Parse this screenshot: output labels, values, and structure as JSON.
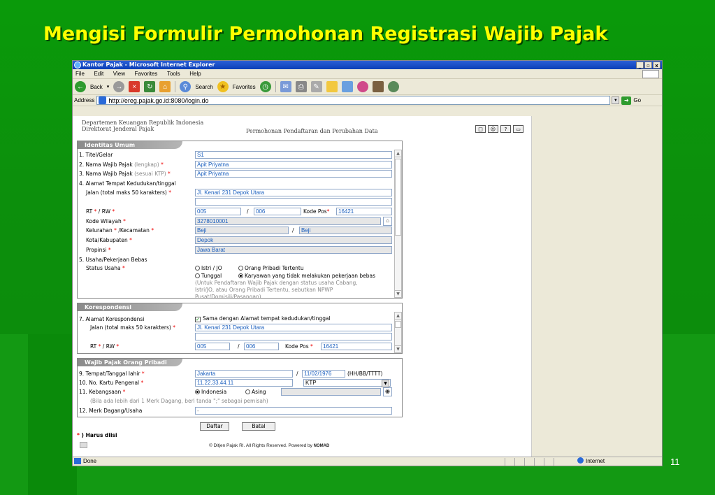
{
  "slide": {
    "title": "Mengisi Formulir Permohonan Registrasi Wajib Pajak",
    "page_number": "11"
  },
  "window": {
    "title": "Kantor Pajak - Microsoft Internet Explorer",
    "controls": [
      "_",
      "▫",
      "x"
    ]
  },
  "menu": [
    "File",
    "Edit",
    "View",
    "Favorites",
    "Tools",
    "Help"
  ],
  "toolbar": {
    "back": "Back",
    "search": "Search",
    "favorites": "Favorites"
  },
  "address": {
    "label": "Address",
    "url": "http://ereg.pajak.go.id:8080/login.do",
    "go": "Go"
  },
  "header": {
    "org_line1": "Departemen Keuangan Republik Indonesia",
    "org_line2": "Direktorat Jenderal Pajak",
    "subtitle": "Permohonan Pendaftaran dan Perubahan Data"
  },
  "identitas": {
    "heading": "Identitas Umum",
    "titel_label": "1. Titel/Gelar",
    "titel_value": "S1",
    "nama_label": "2. Nama Wajib Pajak",
    "nama_hint": "(lengkap)",
    "nama_value": "Apit Priyatna",
    "nama_ktp_label": "3. Nama Wajib Pajak",
    "nama_ktp_hint": "(sesuai KTP)",
    "nama_ktp_value": "Apit Priyatna",
    "alamat_label": "4. Alamat Tempat Kedudukan/tinggal",
    "jalan_label": "Jalan (total maks 50 karakters)",
    "jalan_value": "Jl. Kenari 231 Depok Utara",
    "rtrw_label": "RT",
    "rw_label": "/ RW",
    "rt_value": "005",
    "slash": "/",
    "rw_value": "006",
    "kodepos_label": "Kode Pos",
    "kodepos_value": "16421",
    "wilayah_label": "Kode Wilayah",
    "wilayah_value": "3278010001",
    "kelurahan_label": "Kelurahan",
    "kecamatan_label": "/Kecamatan",
    "kelurahan_value": "Beji",
    "kecamatan_value": "Beji",
    "kota_label": "Kota/Kabupaten",
    "kota_value": "Depok",
    "propinsi_label": "Propinsi",
    "propinsi_value": "Jawa Barat",
    "usaha_label": "5. Usaha/Pekerjaan Bebas",
    "status_label": "Status Usaha",
    "opt_istri": "Istri / JO",
    "opt_orang": "Orang Pribadi Tertentu",
    "opt_tunggal": "Tunggal",
    "opt_karyawan": "Karyawan yang tidak melakukan pekerjaan bebas",
    "note1": "(Untuk Pendaftaran Wajib Pajak dengan status usaha Cabang,",
    "note2": "Istri/JO, atau Orang Pribadi Tertentu, sebutkan NPWP",
    "note3": "Pusat/Domisili/Pasangan)"
  },
  "korespondensi": {
    "heading": "Korespondensi",
    "alamat_label": "7.  Alamat Korespondensi",
    "same_label": "Sama dengan Alamat tempat kedudukan/tinggal",
    "jalan_label": "Jalan (total maks 50 karakters)",
    "jalan_value": "Jl. Kenari 231 Depok Utara",
    "rt_label": "RT",
    "rw_label": "/ RW",
    "rt_value": "005",
    "slash": "/",
    "rw_value": "006",
    "kodepos_label": "Kode Pos",
    "kodepos_value": "16421"
  },
  "pribadi": {
    "heading": "Wajib Pajak Orang Pribadi",
    "tempat_label": "9.  Tempat/Tanggal lahir",
    "tempat_value": "Jakarta",
    "slash": "/",
    "tanggal_value": "11/02/1976",
    "date_format": "(HH/BB/TTTT)",
    "kartu_label": "10. No. Kartu Pengenal",
    "kartu_value": "11.22.33.44.11",
    "kartu_type": "KTP",
    "kebangsaan_label": "11. Kebangsaan",
    "opt_indonesia": "Indonesia",
    "opt_asing": "Asing",
    "merk_hint": "(Bila ada lebih dari 1 Merk Dagang, beri tanda \";\" sebagai pemisah)",
    "merk_label": "12. Merk Dagang/Usaha",
    "merk_value": "-"
  },
  "buttons": {
    "daftar": "Daftar",
    "batal": "Batal"
  },
  "required_note": "Harus diisi",
  "required_mark": "*",
  "footer": "© Ditjen Pajak RI. All Rights Reserved. Powered by",
  "footer_brand": "NOMAD",
  "status": {
    "left": "Done",
    "zone": "Internet"
  }
}
